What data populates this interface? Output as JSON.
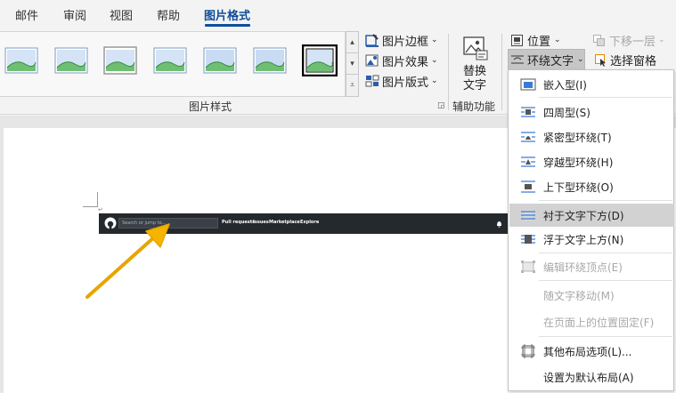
{
  "tabs": [
    "邮件",
    "审阅",
    "视图",
    "帮助",
    "图片格式"
  ],
  "active_tab": "图片格式",
  "ribbon": {
    "picture_styles": {
      "commands": [
        "图片边框",
        "图片效果",
        "图片版式"
      ],
      "group_label": "图片样式"
    },
    "accessibility": {
      "alt_text_line1": "替换",
      "alt_text_line2": "文字",
      "group_label": "辅助功能"
    },
    "arrange": {
      "position": "位置",
      "send_backward": "下移一层",
      "wrap_text": "环绕文字",
      "selection_pane": "选择窗格"
    }
  },
  "document": {
    "github_header": {
      "search_placeholder": "Search or jump to...",
      "nav": [
        "Pull requests",
        "Issues",
        "Marketplace",
        "Explore"
      ]
    }
  },
  "wrap_menu": {
    "items": [
      {
        "label": "嵌入型(I)",
        "icon": "inline-wrap-icon",
        "enabled": true,
        "highlighted": false
      },
      {
        "label": "四周型(S)",
        "icon": "square-wrap-icon",
        "enabled": true,
        "highlighted": false
      },
      {
        "label": "紧密型环绕(T)",
        "icon": "tight-wrap-icon",
        "enabled": true,
        "highlighted": false
      },
      {
        "label": "穿越型环绕(H)",
        "icon": "through-wrap-icon",
        "enabled": true,
        "highlighted": false
      },
      {
        "label": "上下型环绕(O)",
        "icon": "top-bottom-wrap-icon",
        "enabled": true,
        "highlighted": false
      },
      {
        "label": "衬于文字下方(D)",
        "icon": "behind-text-icon",
        "enabled": true,
        "highlighted": true
      },
      {
        "label": "浮于文字上方(N)",
        "icon": "in-front-text-icon",
        "enabled": true,
        "highlighted": false
      },
      {
        "label": "编辑环绕顶点(E)",
        "icon": "edit-wrap-points-icon",
        "enabled": false,
        "highlighted": false
      },
      {
        "label": "随文字移动(M)",
        "icon": "",
        "enabled": false,
        "highlighted": false
      },
      {
        "label": "在页面上的位置固定(F)",
        "icon": "",
        "enabled": false,
        "highlighted": false
      },
      {
        "label": "其他布局选项(L)...",
        "icon": "more-layout-icon",
        "enabled": true,
        "highlighted": false
      },
      {
        "label": "设置为默认布局(A)",
        "icon": "",
        "enabled": true,
        "highlighted": false
      }
    ]
  },
  "colors": {
    "accent": "#0e4d9b",
    "annotation_arrow": "#f5b400",
    "menu_highlight": "#d2d2d2",
    "github_header": "#24292e"
  }
}
